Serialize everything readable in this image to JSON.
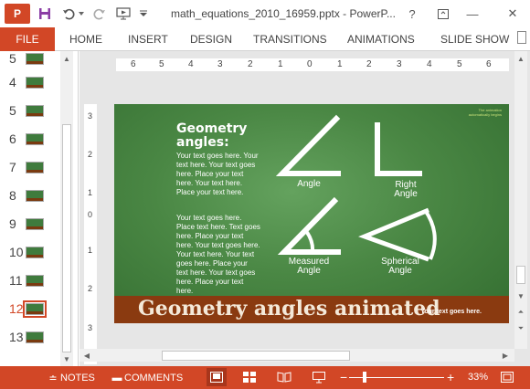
{
  "titlebar": {
    "app_logo": "P",
    "doc_title": "math_equations_2010_16959.pptx - PowerP...",
    "help": "?",
    "minimize": "—",
    "close": "✕",
    "icons": [
      "save-icon",
      "undo-icon",
      "redo-icon",
      "start-from-beginning-icon",
      "customize-icon"
    ]
  },
  "ribbon": {
    "file_tab": "FILE",
    "tabs": [
      "HOME",
      "INSERT",
      "DESIGN",
      "TRANSITIONS",
      "ANIMATIONS",
      "SLIDE SHOW"
    ],
    "accent": "#d24726"
  },
  "thumbnails": [
    {
      "num": "5"
    },
    {
      "num": "4"
    },
    {
      "num": "5"
    },
    {
      "num": "6"
    },
    {
      "num": "7"
    },
    {
      "num": "8"
    },
    {
      "num": "9"
    },
    {
      "num": "10"
    },
    {
      "num": "11"
    },
    {
      "num": "12",
      "active": true
    },
    {
      "num": "13"
    }
  ],
  "ruler": {
    "h_ticks": [
      "6",
      "5",
      "4",
      "3",
      "2",
      "1",
      "0",
      "1",
      "2",
      "3",
      "4",
      "5",
      "6"
    ],
    "v_ticks": [
      "3",
      "2",
      "1",
      "0",
      "1",
      "2",
      "3"
    ]
  },
  "slide": {
    "title": "Geometry\nangles:",
    "body_1": "Your text goes here. Your text here. Your text goes here. Place your text here. Your text here. Place your text here.",
    "body_2": "Your text goes here. Place text here. Text goes here. Place your text here. Your text goes here. Your text here. Your text goes here. Place your text here. Your text goes here. Place your text here.",
    "note": "The animation automatically begins",
    "labels": {
      "angle": "Angle",
      "right_angle": "Right\nAngle",
      "measured_angle": "Measured\nAngle",
      "spherical_angle": "Spherical\nAngle"
    },
    "banner_title": "Geometry angles animated",
    "banner_sub": "Your text goes here.",
    "colors": {
      "board": "#4a8744",
      "banner": "#8a3a10"
    }
  },
  "statusbar": {
    "notes": "NOTES",
    "comments": "COMMENTS",
    "zoom": "33%",
    "zoom_level": 0.33
  }
}
